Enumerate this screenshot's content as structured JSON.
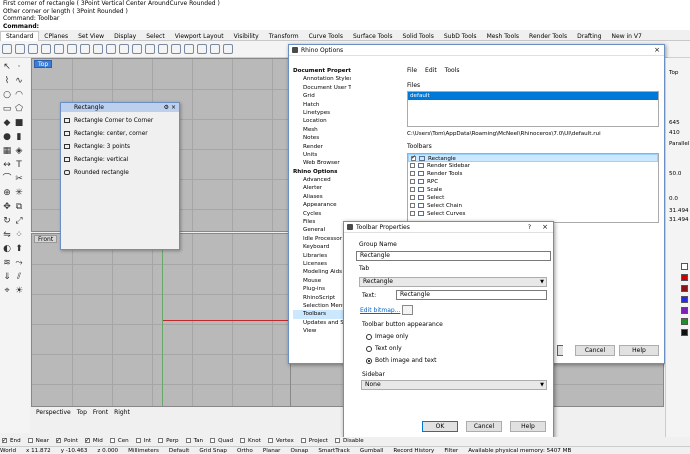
{
  "command_history": [
    "First corner of rectangle ( 3Point  Vertical  Center  AroundCurve  Rounded )",
    "Other corner or length ( 3Point  Rounded )",
    "Command: Toolbar"
  ],
  "command_prompt": "Command:",
  "toolbar_tabs": [
    "Standard",
    "CPlanes",
    "Set View",
    "Display",
    "Select",
    "Viewport Layout",
    "Visibility",
    "Transform",
    "Curve Tools",
    "Surface Tools",
    "Solid Tools",
    "SubD Tools",
    "Mesh Tools",
    "Render Tools",
    "Drafting",
    "New in V7"
  ],
  "viewports": {
    "top": "Top",
    "front": "Front"
  },
  "viewport_tabs": [
    "Perspective",
    "Top",
    "Front",
    "Right"
  ],
  "rectangle_flyout": {
    "title": "Rectangle",
    "items": [
      "Rectangle Corner to Corner",
      "Rectangle: center, corner",
      "Rectangle: 3 points",
      "Rectangle: vertical",
      "Rounded rectangle"
    ]
  },
  "rhino_options": {
    "title": "Rhino Options",
    "tree": [
      {
        "label": "Document Properties",
        "bold": true
      },
      {
        "label": "Annotation Styles"
      },
      {
        "label": "Document User Text"
      },
      {
        "label": "Grid"
      },
      {
        "label": "Hatch"
      },
      {
        "label": "Linetypes"
      },
      {
        "label": "Location"
      },
      {
        "label": "Mesh"
      },
      {
        "label": "Notes"
      },
      {
        "label": "Render"
      },
      {
        "label": "Units"
      },
      {
        "label": "Web Browser"
      },
      {
        "label": "Rhino Options",
        "bold": true
      },
      {
        "label": "Advanced"
      },
      {
        "label": "Alerter"
      },
      {
        "label": "Aliases"
      },
      {
        "label": "Appearance"
      },
      {
        "label": "Cycles"
      },
      {
        "label": "Files"
      },
      {
        "label": "General"
      },
      {
        "label": "Idle Processor"
      },
      {
        "label": "Keyboard"
      },
      {
        "label": "Libraries"
      },
      {
        "label": "Licenses"
      },
      {
        "label": "Modeling Aids"
      },
      {
        "label": "Mouse"
      },
      {
        "label": "Plug-ins"
      },
      {
        "label": "RhinoScript"
      },
      {
        "label": "Selection Menu"
      },
      {
        "label": "Toolbars",
        "selected": true
      },
      {
        "label": "Updates and Stat"
      },
      {
        "label": "View"
      }
    ],
    "menu": [
      "File",
      "Edit",
      "Tools"
    ],
    "files_label": "Files",
    "files_selected": "default",
    "file_path": "C:\\Users\\Tom\\AppData\\Roaming\\McNeel\\Rhinoceros\\7.0\\UI\\default.rui",
    "toolbars_label": "Toolbars",
    "toolbars": [
      {
        "label": "Rectangle",
        "checked": true,
        "selected": true
      },
      {
        "label": "Render Sidebar",
        "checked": false
      },
      {
        "label": "Render Tools",
        "checked": false
      },
      {
        "label": "RPC",
        "checked": false
      },
      {
        "label": "Scale",
        "checked": false
      },
      {
        "label": "Select",
        "checked": false
      },
      {
        "label": "Select Chain",
        "checked": false
      },
      {
        "label": "Select Curves",
        "checked": false
      }
    ],
    "cancel": "Cancel",
    "help": "Help"
  },
  "toolbar_props": {
    "title": "Toolbar Properties",
    "help_q": "?",
    "group_name_label": "Group Name",
    "group_name_value": "Rectangle",
    "tab_label": "Tab",
    "tab_value": "Rectangle",
    "text_label": "Text:",
    "text_value": "Rectangle",
    "edit_bitmap": "Edit bitmap...",
    "appearance_label": "Toolbar button appearance",
    "options": [
      "Image only",
      "Text only",
      "Both image and text"
    ],
    "selected_option": 2,
    "sidebar_label": "Sidebar",
    "sidebar_value": "None",
    "ok": "OK",
    "cancel": "Cancel",
    "help": "Help"
  },
  "osnaps": [
    {
      "label": "End",
      "checked": true
    },
    {
      "label": "Near",
      "checked": false
    },
    {
      "label": "Point",
      "checked": true
    },
    {
      "label": "Mid",
      "checked": true
    },
    {
      "label": "Cen",
      "checked": false
    },
    {
      "label": "Int",
      "checked": false
    },
    {
      "label": "Perp",
      "checked": false
    },
    {
      "label": "Tan",
      "checked": false
    },
    {
      "label": "Quad",
      "checked": false
    },
    {
      "label": "Knot",
      "checked": false
    },
    {
      "label": "Vertex",
      "checked": false
    },
    {
      "label": "Project",
      "checked": false
    },
    {
      "label": "Disable",
      "checked": false
    }
  ],
  "status": [
    "World",
    "x 11.872",
    "y -10.463",
    "z 0.000",
    "Millimeters",
    "Default",
    "Grid Snap",
    "Ortho",
    "Planar",
    "Osnap",
    "SmartTrack",
    "Gumball",
    "Record History",
    "Filter",
    "Available physical memory: 5407 MB"
  ],
  "props_values": [
    "Top",
    "645",
    "410",
    "Parallel",
    "50.0",
    "0.0",
    "31.494",
    "31.494"
  ]
}
